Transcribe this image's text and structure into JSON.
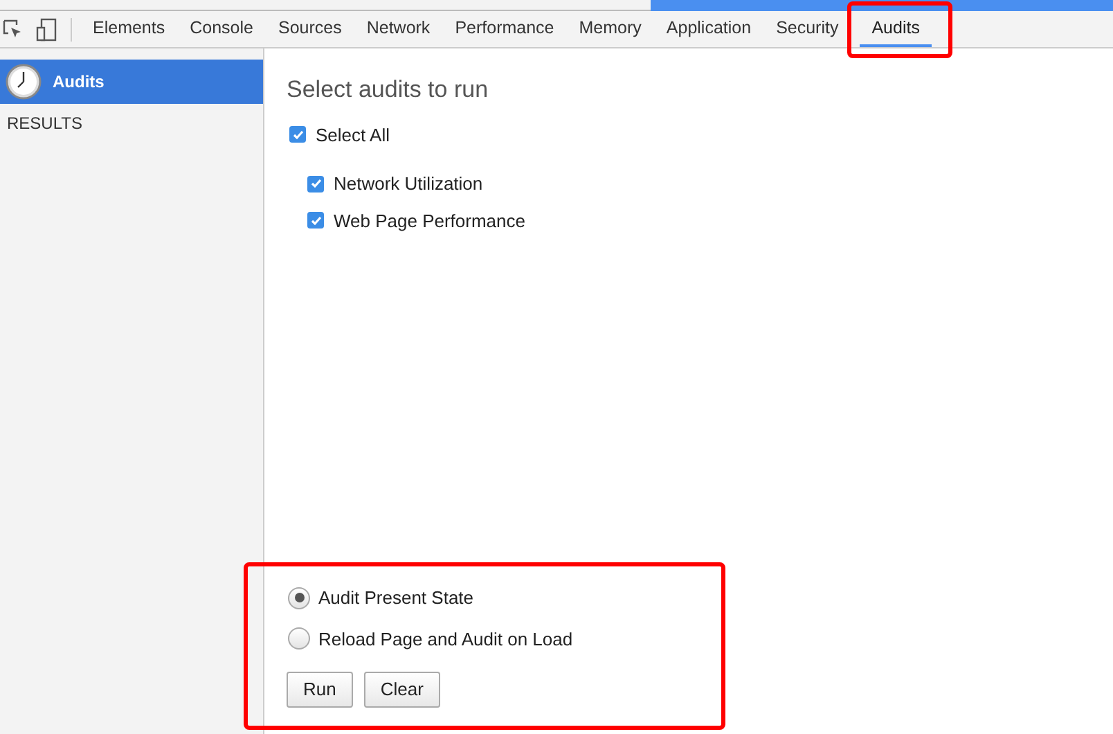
{
  "tabs": [
    {
      "label": "Elements",
      "selected": false
    },
    {
      "label": "Console",
      "selected": false
    },
    {
      "label": "Sources",
      "selected": false
    },
    {
      "label": "Network",
      "selected": false
    },
    {
      "label": "Performance",
      "selected": false
    },
    {
      "label": "Memory",
      "selected": false
    },
    {
      "label": "Application",
      "selected": false
    },
    {
      "label": "Security",
      "selected": false
    },
    {
      "label": "Audits",
      "selected": true
    }
  ],
  "sidebar": {
    "items": [
      {
        "label": "Audits",
        "selected": true
      }
    ],
    "section": "RESULTS"
  },
  "panel": {
    "title": "Select audits to run",
    "select_all": {
      "label": "Select All",
      "checked": true
    },
    "audits": [
      {
        "label": "Network Utilization",
        "checked": true
      },
      {
        "label": "Web Page Performance",
        "checked": true
      }
    ],
    "modes": [
      {
        "label": "Audit Present State",
        "selected": true
      },
      {
        "label": "Reload Page and Audit on Load",
        "selected": false
      }
    ],
    "buttons": [
      "Run",
      "Clear"
    ]
  }
}
